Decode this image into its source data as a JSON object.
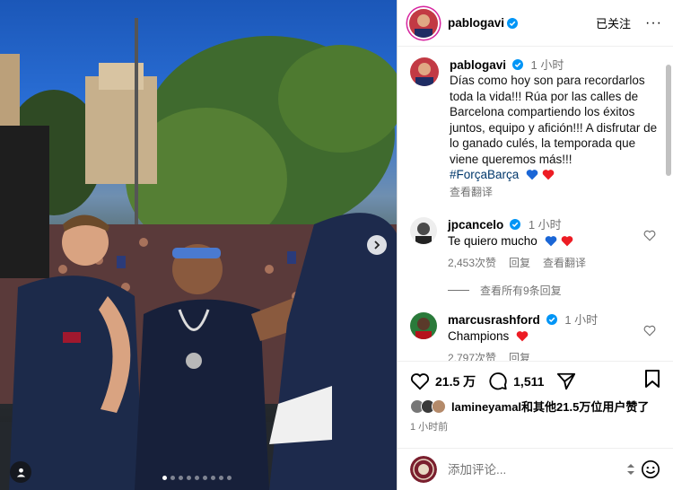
{
  "post": {
    "username": "pablogavi",
    "follow_label": "已关注",
    "more_label": "···",
    "caption_time": "1 小时",
    "caption_text": "Días como hoy son para recordarlos toda la vida!!! Rúa por las calles de Barcelona compartiendo los éxitos juntos, equipo y afición!!! A disfrutar de lo ganado culés, la temporada que viene queremos más!!!",
    "hashtag": "#ForçaBarça",
    "translate_label": "查看翻译"
  },
  "comments": [
    {
      "username": "jpcancelo",
      "time": "1 小时",
      "text": "Te quiero mucho",
      "likes": "2,453次赞",
      "reply": "回复",
      "translate": "查看翻译"
    },
    {
      "username": "marcusrashford",
      "time": "1 小时",
      "text": "Champions",
      "likes": "2,797次赞",
      "reply": "回复"
    }
  ],
  "view_replies": "查看所有9条回复",
  "actions": {
    "like_count": "21.5 万",
    "comment_count": "1,511"
  },
  "likes_line": "lamineyamal和其他21.5万位用户赞了",
  "post_time": "1 小时前",
  "comment_input": {
    "placeholder": "添加评论..."
  },
  "carousel": {
    "total": 9,
    "active": 0
  },
  "icons": {
    "heart_icon": "heart-icon",
    "comment_icon": "comment-icon",
    "share_icon": "share-icon",
    "save_icon": "bookmark-icon",
    "verified_icon": "verified-badge-icon",
    "next_icon": "chevron-right-icon",
    "tag_icon": "user-tag-icon",
    "emoji_icon": "emoji-icon"
  },
  "colors": {
    "verified": "#0095f6",
    "link": "#00376b",
    "muted": "#737373",
    "heart_red": "#ed1c24",
    "heart_blue": "#1a66d6"
  }
}
